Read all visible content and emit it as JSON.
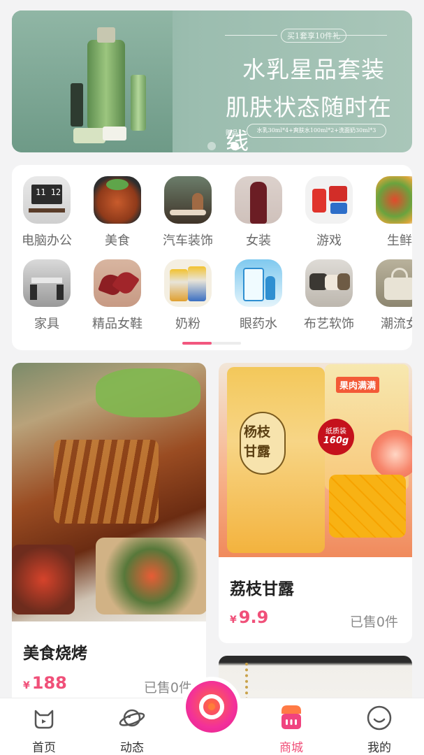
{
  "banner": {
    "tagline": "买1套享10件礼",
    "headline1": "水乳星品套装",
    "headline2": "肌肤状态随时在线",
    "gift_label": "赠品:",
    "gift_items": "水乳30ml*4+爽肤水100ml*2+洗面奶30ml*3"
  },
  "categories": {
    "row1": [
      {
        "label": "电脑办公",
        "icon": "computer-office-icon"
      },
      {
        "label": "美食",
        "icon": "food-icon"
      },
      {
        "label": "汽车装饰",
        "icon": "car-decor-icon"
      },
      {
        "label": "女装",
        "icon": "womens-clothing-icon"
      },
      {
        "label": "游戏",
        "icon": "game-icon"
      },
      {
        "label": "生鲜",
        "icon": "fresh-produce-icon"
      }
    ],
    "row2": [
      {
        "label": "家具",
        "icon": "furniture-icon"
      },
      {
        "label": "精品女鞋",
        "icon": "womens-shoes-icon"
      },
      {
        "label": "奶粉",
        "icon": "milk-powder-icon"
      },
      {
        "label": "眼药水",
        "icon": "eye-drops-icon"
      },
      {
        "label": "布艺软饰",
        "icon": "fabric-decor-icon"
      },
      {
        "label": "潮流女",
        "icon": "fashion-women-icon"
      }
    ]
  },
  "products": [
    {
      "title": "美食烧烤",
      "currency": "¥",
      "price": "188",
      "sold": "已售0件"
    },
    {
      "title": "荔枝甘露",
      "currency": "¥",
      "price": "9.9",
      "sold": "已售0件",
      "pack_label_1": "杨枝",
      "pack_label_2": "甘露",
      "badge_1": "纸质装",
      "badge_2": "160g",
      "side_label": "果肉满满"
    },
    {
      "title": "",
      "currency": "",
      "price": "",
      "sold": ""
    }
  ],
  "tabbar": {
    "items": [
      {
        "label": "首页",
        "icon": "home-icon"
      },
      {
        "label": "动态",
        "icon": "planet-icon"
      },
      {
        "label": "",
        "icon": "camera-icon"
      },
      {
        "label": "商城",
        "icon": "shop-icon",
        "active": true
      },
      {
        "label": "我的",
        "icon": "profile-icon"
      }
    ]
  },
  "colors": {
    "accent": "#f05079",
    "banner_green": "#9bbdaf",
    "text_dark": "#222222",
    "text_gray": "#8a8a8a"
  }
}
